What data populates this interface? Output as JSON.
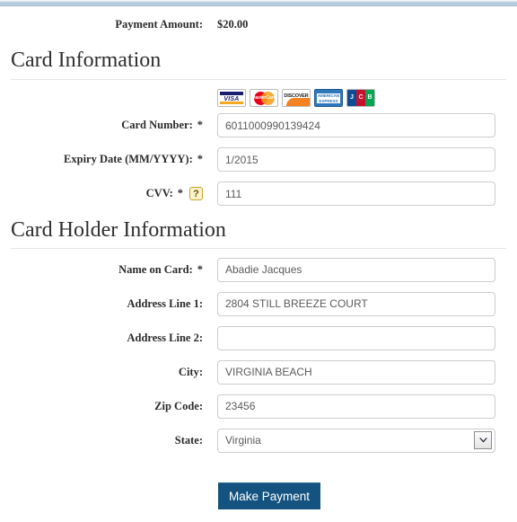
{
  "payment_summary": {
    "label": "Payment Amount:",
    "amount": "$20.00"
  },
  "card_information": {
    "heading": "Card Information",
    "accepted_cards": [
      {
        "name": "visa-logo",
        "text": "VISA"
      },
      {
        "name": "mastercard-logo",
        "text": "MasterCard"
      },
      {
        "name": "discover-logo",
        "text": "DISCOVER"
      },
      {
        "name": "amex-logo",
        "text1": "AMERICAN",
        "text2": "EXPRESS"
      },
      {
        "name": "jcb-logo",
        "j": "J",
        "c": "C",
        "b": "B"
      }
    ],
    "fields": {
      "card_number": {
        "label": "Card Number:",
        "required_marker": "*",
        "value": "6011000990139424",
        "placeholder": ""
      },
      "expiry_date": {
        "label": "Expiry Date (MM/YYYY):",
        "required_marker": "*",
        "value": "1/2015",
        "placeholder": ""
      },
      "cvv": {
        "label": "CVV:",
        "required_marker": "*",
        "help_icon": "?",
        "value": "111",
        "placeholder": ""
      }
    }
  },
  "card_holder_information": {
    "heading": "Card Holder Information",
    "fields": {
      "name_on_card": {
        "label": "Name on Card:",
        "required_marker": "*",
        "value": "Abadie Jacques",
        "placeholder": ""
      },
      "address_line_1": {
        "label": "Address Line 1:",
        "value": "2804 STILL BREEZE COURT",
        "placeholder": ""
      },
      "address_line_2": {
        "label": "Address Line 2:",
        "value": "",
        "placeholder": ""
      },
      "city": {
        "label": "City:",
        "value": "VIRGINIA BEACH",
        "placeholder": ""
      },
      "zip_code": {
        "label": "Zip Code:",
        "value": "23456",
        "placeholder": ""
      },
      "state": {
        "label": "State:",
        "value": "Virginia"
      }
    }
  },
  "submit": {
    "label": "Make Payment"
  },
  "colors": {
    "button_background": "#14537f",
    "field_border": "#cccccc",
    "heading_text": "#2f2f2f",
    "help_icon_border": "#c9a227"
  }
}
